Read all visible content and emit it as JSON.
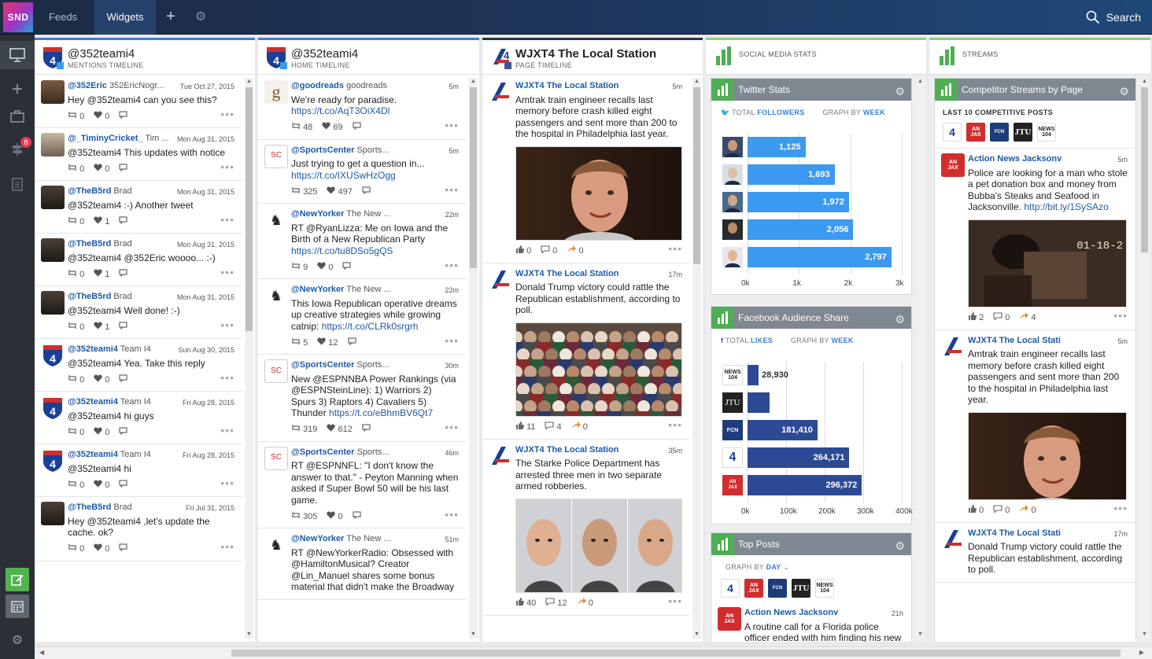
{
  "app": {
    "logo": "SND"
  },
  "tabs": [
    {
      "label": "Feeds"
    },
    {
      "label": "Widgets"
    }
  ],
  "search_label": "Search",
  "sidebar": {
    "notification_count": "8"
  },
  "columns": [
    {
      "title": "@352teami4",
      "subtitle": "MENTIONS TIMELINE",
      "posts": [
        {
          "handle": "@352Eric",
          "name": "352EricNogr...",
          "time": "Tue Oct 27, 2015",
          "text": "Hey @352teami4 can you see this?",
          "rt": "0",
          "likes": "0"
        },
        {
          "handle": "@_TiminyCricket_",
          "name": "Tim ...",
          "time": "Mon Aug 31, 2015",
          "text": "@352teami4 This updates with notice",
          "rt": "0",
          "likes": "0"
        },
        {
          "handle": "@TheB5rd",
          "name": "Brad",
          "time": "Mon Aug 31, 2015",
          "text": "@352teami4 :-) Another tweet",
          "rt": "0",
          "likes": "1"
        },
        {
          "handle": "@TheB5rd",
          "name": "Brad",
          "time": "Mon Aug 31, 2015",
          "text": "@352teami4 @352Eric woooo... :-)",
          "rt": "0",
          "likes": "1"
        },
        {
          "handle": "@TheB5rd",
          "name": "Brad",
          "time": "Mon Aug 31, 2015",
          "text": "@352teami4 Well done! :-)",
          "rt": "0",
          "likes": "1"
        },
        {
          "handle": "@352teami4",
          "name": "Team I4",
          "time": "Sun Aug 30, 2015",
          "text": "@352teami4 Yea. Take this reply",
          "rt": "0",
          "likes": "0"
        },
        {
          "handle": "@352teami4",
          "name": "Team I4",
          "time": "Fri Aug 28, 2015",
          "text": "@352teami4 hi guys",
          "rt": "0",
          "likes": "0"
        },
        {
          "handle": "@352teami4",
          "name": "Team I4",
          "time": "Fri Aug 28, 2015",
          "text": "@352teami4 hi",
          "rt": "0",
          "likes": "0"
        },
        {
          "handle": "@TheB5rd",
          "name": "Brad",
          "time": "Fri Jul 31, 2015",
          "text": "Hey @352teami4 ,let's update the cache. ok?",
          "rt": "0",
          "likes": "0"
        }
      ]
    },
    {
      "title": "@352teami4",
      "subtitle": "HOME TIMELINE",
      "posts": [
        {
          "handle": "@goodreads",
          "name": "goodreads",
          "time": "5m",
          "text": "We're ready for paradise.",
          "link": "https://t.co/AqT3OiX4Dl",
          "rt": "48",
          "likes": "69"
        },
        {
          "handle": "@SportsCenter",
          "name": "Sports...",
          "time": "5m",
          "text": "Just trying to get a question in...",
          "link": "https://t.co/IXUSwHzOgg",
          "rt": "325",
          "likes": "497"
        },
        {
          "handle": "@NewYorker",
          "name": "The New ...",
          "time": "22m",
          "text": "RT @RyanLizza: Me on Iowa and the Birth of a New Republican Party",
          "link": "https://t.co/tu8DSo5gQS",
          "rt": "9",
          "likes": "0"
        },
        {
          "handle": "@NewYorker",
          "name": "The New ...",
          "time": "22m",
          "text": "This Iowa Republican operative dreams up creative strategies while growing catnip:",
          "link": "https://t.co/CLRk0srgrh",
          "rt": "5",
          "likes": "12"
        },
        {
          "handle": "@SportsCenter",
          "name": "Sports...",
          "time": "30m",
          "text": "New @ESPNNBA Power Rankings (via @ESPNSteinLine): 1) Warriors 2) Spurs 3) Raptors 4) Cavaliers 5) Thunder",
          "link": "https://t.co/eBhmBV6Qt7",
          "rt": "319",
          "likes": "612"
        },
        {
          "handle": "@SportsCenter",
          "name": "Sports...",
          "time": "46m",
          "text": "RT @ESPNNFL: \"I don't know the answer to that.\" - Peyton Manning when asked if Super Bowl 50 will be his last game.",
          "link": "",
          "rt": "305",
          "likes": "0"
        },
        {
          "handle": "@NewYorker",
          "name": "The New ...",
          "time": "51m",
          "text": "RT @NewYorkerRadio: Obsessed with @HamiltonMusical? Creator @Lin_Manuel shares some bonus material that didn't make the Broadway",
          "link": "",
          "rt": "",
          "likes": ""
        }
      ]
    },
    {
      "title": "WJXT4 The Local Station",
      "subtitle": "PAGE TIMELINE",
      "posts": [
        {
          "handle": "WJXT4 The Local Station",
          "time": "5m",
          "text": "Amtrak train engineer recalls last memory before crash killed eight passengers and sent more than 200 to the hospital in Philadelphia last year.",
          "likes": "0",
          "comments": "0",
          "shares": "0"
        },
        {
          "handle": "WJXT4 The Local Station",
          "time": "17m",
          "text": "Donald Trump victory could rattle the Republican establishment, according to poll.",
          "likes": "11",
          "comments": "4",
          "shares": "0"
        },
        {
          "handle": "WJXT4 The Local Station",
          "time": "35m",
          "text": "The Starke Police Department has arrested three men in two separate armed robberies.",
          "likes": "40",
          "comments": "12",
          "shares": "0"
        }
      ]
    }
  ],
  "social_stats": {
    "header": "SOCIAL MEDIA STATS",
    "twitter": {
      "title": "Twitter Stats",
      "meta_total": "TOTAL",
      "meta_metric": "FOLLOWERS",
      "meta_graph": "GRAPH BY",
      "meta_period": "WEEK",
      "ticks": [
        "0k",
        "1k",
        "2k",
        "3k"
      ]
    },
    "facebook": {
      "title": "Facebook Audience Share",
      "meta_total": "TOTAL",
      "meta_metric": "LIKES",
      "meta_graph": "GRAPH BY",
      "meta_period": "WEEK",
      "ticks": [
        "0k",
        "100k",
        "200k",
        "300k",
        "400k"
      ]
    },
    "top_posts": {
      "title": "Top Posts",
      "meta_graph": "GRAPH BY",
      "meta_period": "DAY",
      "post": {
        "handle": "Action News Jacksonv",
        "time": "21h",
        "text": "A routine call for a Florida police officer ended with him finding his new"
      }
    }
  },
  "chart_data": [
    {
      "type": "bar",
      "title": "Twitter Stats",
      "orientation": "horizontal",
      "values": [
        1125,
        1693,
        1972,
        2056,
        2797
      ],
      "value_labels": [
        "1,125",
        "1,693",
        "1,972",
        "2,056",
        "2,797"
      ],
      "xlim": [
        0,
        3000
      ],
      "color": "#3b99f0"
    },
    {
      "type": "bar",
      "title": "Facebook Audience Share",
      "orientation": "horizontal",
      "values": [
        28930,
        58000,
        181410,
        264171,
        296372
      ],
      "value_labels": [
        "28,930",
        "",
        "181,410",
        "264,171",
        "296,372"
      ],
      "xlim": [
        0,
        400000
      ],
      "color": "#2c4a94"
    }
  ],
  "streams": {
    "header": "STREAMS",
    "panel_title": "Competitor Streams by Page",
    "last_posts": "LAST 10 COMPETITIVE POSTS",
    "posts": [
      {
        "handle": "Action News Jacksonv",
        "time": "5m",
        "text": "Police are looking for a man who stole a pet donation box and money from Bubba's Steaks and Seafood in Jacksonville.",
        "link": "http://bit.ly/1SySAzo",
        "likes": "2",
        "comments": "0",
        "shares": "4",
        "img_text": "01-18-2"
      },
      {
        "handle": "WJXT4 The Local Stati",
        "time": "5m",
        "text": "Amtrak train engineer recalls last memory before crash killed eight passengers and sent more than 200 to the hospital in Philadelphia last year.",
        "likes": "0",
        "comments": "0",
        "shares": "0"
      },
      {
        "handle": "WJXT4 The Local Stati",
        "time": "17m",
        "text": "Donald Trump victory could rattle the Republican establishment, according to poll."
      }
    ]
  }
}
